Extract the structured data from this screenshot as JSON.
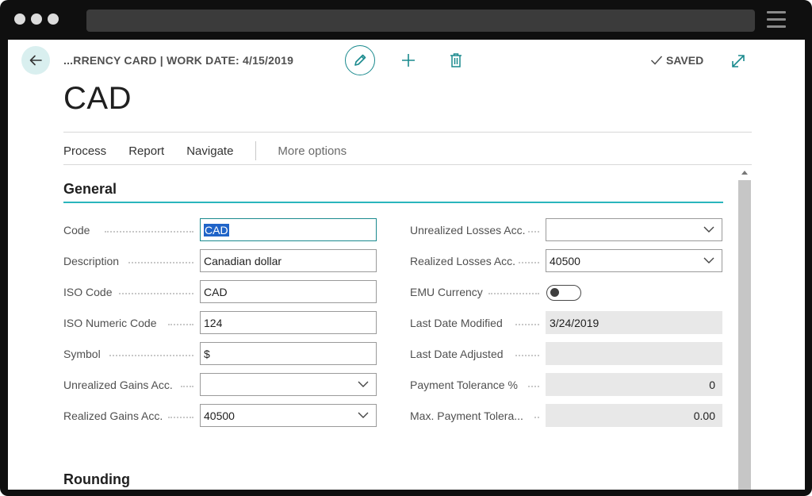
{
  "window": {
    "back_icon": "arrow-left-icon"
  },
  "header": {
    "breadcrumb": "...RRENCY CARD | WORK DATE: 4/15/2019",
    "status": "SAVED",
    "icons": {
      "edit": "pencil-icon",
      "add": "plus-icon",
      "delete": "trash-icon",
      "saved": "checkmark-icon",
      "expand": "expand-icon"
    }
  },
  "page": {
    "title": "CAD"
  },
  "actions": {
    "process": "Process",
    "report": "Report",
    "navigate": "Navigate",
    "more": "More options"
  },
  "general": {
    "title": "General",
    "left": {
      "code": {
        "label": "Code",
        "value": "CAD"
      },
      "description": {
        "label": "Description",
        "value": "Canadian dollar"
      },
      "iso_code": {
        "label": "ISO Code",
        "value": "CAD"
      },
      "iso_numeric_code": {
        "label": "ISO Numeric Code",
        "value": "124"
      },
      "symbol": {
        "label": "Symbol",
        "value": "$"
      },
      "unrealized_gains_acc": {
        "label": "Unrealized Gains Acc.",
        "value": ""
      },
      "realized_gains_acc": {
        "label": "Realized Gains Acc.",
        "value": "40500"
      }
    },
    "right": {
      "unrealized_losses_acc": {
        "label": "Unrealized Losses Acc.",
        "value": ""
      },
      "realized_losses_acc": {
        "label": "Realized Losses Acc.",
        "value": "40500"
      },
      "emu_currency": {
        "label": "EMU Currency",
        "value": false
      },
      "last_date_modified": {
        "label": "Last Date Modified",
        "value": "3/24/2019"
      },
      "last_date_adjusted": {
        "label": "Last Date Adjusted",
        "value": ""
      },
      "payment_tolerance_pct": {
        "label": "Payment Tolerance %",
        "value": "0"
      },
      "max_payment_tolerance": {
        "label": "Max. Payment Tolera...",
        "value": "0.00"
      }
    }
  },
  "rounding": {
    "title": "Rounding"
  },
  "colors": {
    "accent": "#1a8a8e",
    "section_rule": "#2ab5bd",
    "selection": "#2064c8"
  }
}
